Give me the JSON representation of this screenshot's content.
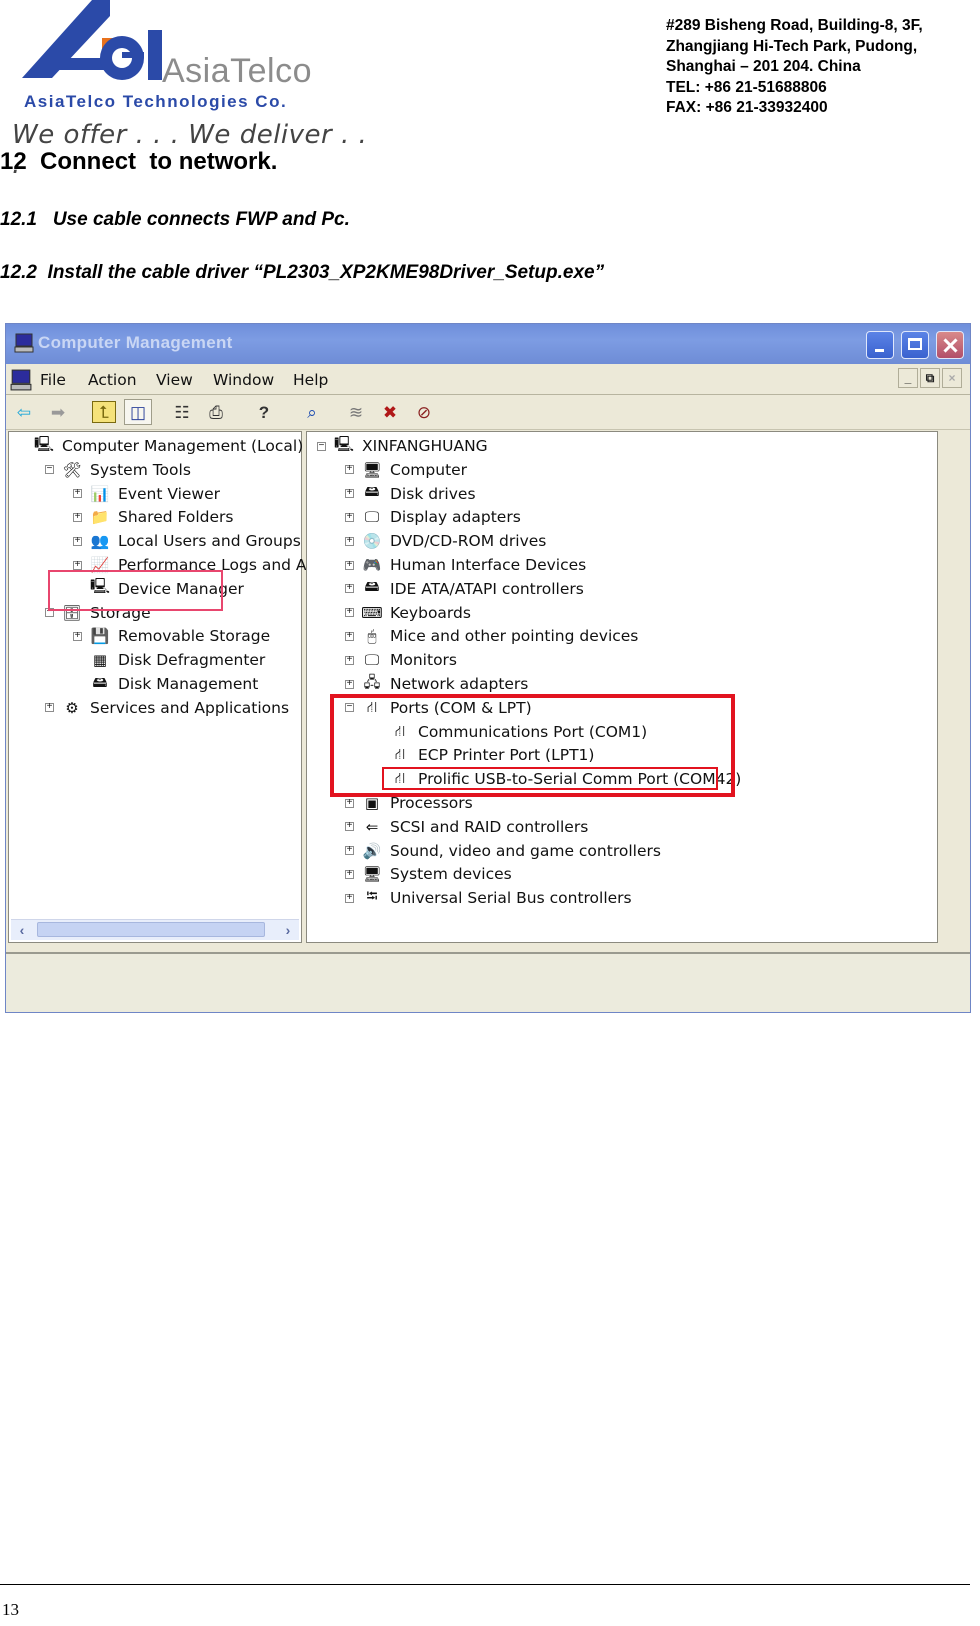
{
  "letterhead": {
    "logo_mark": "Ael",
    "brand_word": "AsiaTelco",
    "company_name": "AsiaTelco Technologies Co.",
    "tagline": "We offer . . . We deliver . . .",
    "address_lines": [
      "#289 Bisheng Road, Building-8, 3F,",
      "Zhangjiang Hi-Tech Park, Pudong,",
      "Shanghai – 201 204. China",
      "TEL: +86 21-51688806",
      "FAX: +86 21-33932400"
    ],
    "colors": {
      "brand_blue": "#2b4aa8",
      "brand_orange": "#e8711c",
      "brand_gray": "#8c8c8c"
    }
  },
  "document": {
    "section_heading": "12  Connect  to network.",
    "steps": [
      "12.1   Use cable connects FWP and Pc.",
      "12.2  Install the cable driver “PL2303_XP2KME98Driver_Setup.exe”"
    ],
    "page_number": "13"
  },
  "window": {
    "title": "Computer Management",
    "menu": [
      "File",
      "Action",
      "View",
      "Window",
      "Help"
    ],
    "mdi_buttons": [
      "minimize",
      "restore",
      "close"
    ],
    "toolbar": [
      {
        "name": "back",
        "icon": "back-arrow-icon",
        "glyph": "⇦"
      },
      {
        "name": "forward",
        "icon": "forward-arrow-icon",
        "glyph": "➡"
      },
      {
        "name": "up-one-level",
        "icon": "folder-up-icon",
        "glyph": "⮤"
      },
      {
        "name": "show-hide-console-tree",
        "icon": "console-tree-icon",
        "glyph": "◫"
      },
      {
        "name": "properties",
        "icon": "properties-icon",
        "glyph": "☷"
      },
      {
        "name": "print",
        "icon": "printer-icon",
        "glyph": "⎙"
      },
      {
        "name": "help",
        "icon": "help-icon",
        "glyph": "?"
      },
      {
        "name": "scan-hardware",
        "icon": "scan-hardware-icon",
        "glyph": "⌕"
      },
      {
        "name": "update-driver",
        "icon": "update-driver-icon",
        "glyph": "≋"
      },
      {
        "name": "uninstall",
        "icon": "uninstall-icon",
        "glyph": "✖"
      },
      {
        "name": "disable",
        "icon": "disable-icon",
        "glyph": "⊘"
      }
    ],
    "left_tree": [
      {
        "label": "Computer Management (Local)",
        "level": 0,
        "expander": "none",
        "icon": "computer-management-icon",
        "glyph": "🖳"
      },
      {
        "label": "System Tools",
        "level": 1,
        "expander": "−",
        "icon": "system-tools-icon",
        "glyph": "🛠"
      },
      {
        "label": "Event Viewer",
        "level": 2,
        "expander": "+",
        "icon": "event-viewer-icon",
        "glyph": "📊"
      },
      {
        "label": "Shared Folders",
        "level": 2,
        "expander": "+",
        "icon": "shared-folders-icon",
        "glyph": "📁"
      },
      {
        "label": "Local Users and Groups",
        "level": 2,
        "expander": "+",
        "icon": "users-icon",
        "glyph": "👥"
      },
      {
        "label": "Performance Logs and Alerts",
        "level": 2,
        "expander": "+",
        "icon": "performance-icon",
        "glyph": "📈"
      },
      {
        "label": "Device Manager",
        "level": 2,
        "expander": "none",
        "icon": "device-manager-icon",
        "glyph": "🖳",
        "highlighted": true
      },
      {
        "label": "Storage",
        "level": 1,
        "expander": "−",
        "icon": "storage-icon",
        "glyph": "🗄"
      },
      {
        "label": "Removable Storage",
        "level": 2,
        "expander": "+",
        "icon": "removable-storage-icon",
        "glyph": "💾"
      },
      {
        "label": "Disk Defragmenter",
        "level": 2,
        "expander": "none",
        "icon": "defragmenter-icon",
        "glyph": "▦"
      },
      {
        "label": "Disk Management",
        "level": 2,
        "expander": "none",
        "icon": "disk-management-icon",
        "glyph": "🖴"
      },
      {
        "label": "Services and Applications",
        "level": 1,
        "expander": "+",
        "icon": "services-icon",
        "glyph": "⚙"
      }
    ],
    "right_tree": [
      {
        "label": "XINFANGHUANG",
        "level": 0,
        "expander": "−",
        "icon": "computer-icon",
        "glyph": "🖳"
      },
      {
        "label": "Computer",
        "level": 1,
        "expander": "+",
        "icon": "computer-icon",
        "glyph": "🖥"
      },
      {
        "label": "Disk drives",
        "level": 1,
        "expander": "+",
        "icon": "disk-drive-icon",
        "glyph": "🖴"
      },
      {
        "label": "Display adapters",
        "level": 1,
        "expander": "+",
        "icon": "display-adapter-icon",
        "glyph": "🖵"
      },
      {
        "label": "DVD/CD-ROM drives",
        "level": 1,
        "expander": "+",
        "icon": "dvd-drive-icon",
        "glyph": "💿"
      },
      {
        "label": "Human Interface Devices",
        "level": 1,
        "expander": "+",
        "icon": "hid-icon",
        "glyph": "🎮"
      },
      {
        "label": "IDE ATA/ATAPI controllers",
        "level": 1,
        "expander": "+",
        "icon": "ide-controller-icon",
        "glyph": "🖴"
      },
      {
        "label": "Keyboards",
        "level": 1,
        "expander": "+",
        "icon": "keyboard-icon",
        "glyph": "⌨"
      },
      {
        "label": "Mice and other pointing devices",
        "level": 1,
        "expander": "+",
        "icon": "mouse-icon",
        "glyph": "🖱"
      },
      {
        "label": "Monitors",
        "level": 1,
        "expander": "+",
        "icon": "monitor-icon",
        "glyph": "🖵"
      },
      {
        "label": "Network adapters",
        "level": 1,
        "expander": "+",
        "icon": "network-adapter-icon",
        "glyph": "🖧"
      },
      {
        "label": "Ports (COM & LPT)",
        "level": 1,
        "expander": "−",
        "icon": "port-icon",
        "glyph": "⛙"
      },
      {
        "label": "Communications Port (COM1)",
        "level": 2,
        "expander": "none",
        "icon": "port-icon",
        "glyph": "⛙"
      },
      {
        "label": "ECP Printer Port (LPT1)",
        "level": 2,
        "expander": "none",
        "icon": "port-icon",
        "glyph": "⛙"
      },
      {
        "label": "Prolific USB-to-Serial Comm Port (COM42)",
        "level": 2,
        "expander": "none",
        "icon": "port-icon",
        "glyph": "⛙",
        "highlighted": true
      },
      {
        "label": "Processors",
        "level": 1,
        "expander": "+",
        "icon": "processor-icon",
        "glyph": "▣"
      },
      {
        "label": "SCSI and RAID controllers",
        "level": 1,
        "expander": "+",
        "icon": "scsi-icon",
        "glyph": "⇐"
      },
      {
        "label": "Sound, video and game controllers",
        "level": 1,
        "expander": "+",
        "icon": "sound-icon",
        "glyph": "🔊"
      },
      {
        "label": "System devices",
        "level": 1,
        "expander": "+",
        "icon": "system-devices-icon",
        "glyph": "🖥"
      },
      {
        "label": "Universal Serial Bus controllers",
        "level": 1,
        "expander": "+",
        "icon": "usb-icon",
        "glyph": "⭾"
      }
    ],
    "scroll_arrows": {
      "left": "‹",
      "right": "›"
    },
    "colors": {
      "titlebar": "#7d9ce3",
      "chrome": "#ece9d8",
      "highlight_red": "#e2131f",
      "highlight_pink": "#e8466e"
    }
  }
}
